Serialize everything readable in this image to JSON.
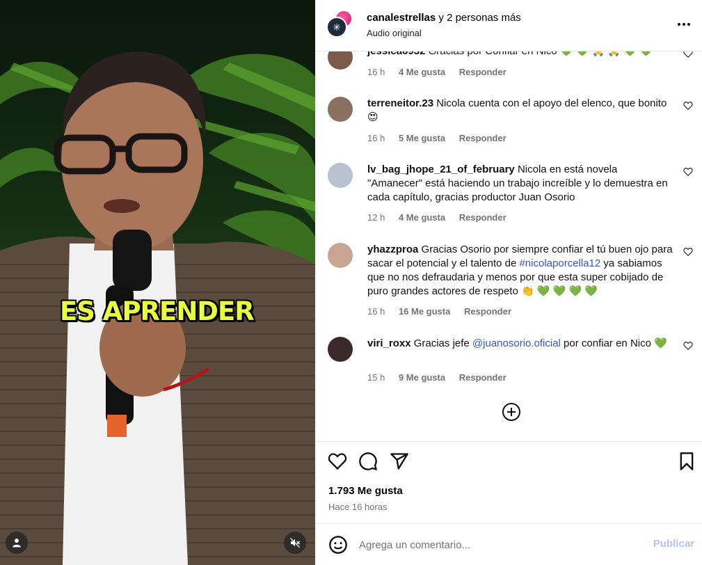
{
  "post": {
    "author": "canalestrellas",
    "coauthors": " y 2 personas más",
    "audio": "Audio original",
    "caption": "ES APRENDER",
    "likes": "1.793 Me gusta",
    "time": "Hace 16 horas"
  },
  "comments": [
    {
      "user": "jessica6932",
      "text": "Gracias por Confiar en Nico",
      "emoji": "💚 💚 🙏 🙏 💚 💚",
      "time": "16 h",
      "likes": "4 Me gusta",
      "reply": "Responder",
      "avatar_color": "#7a5a4a"
    },
    {
      "user": "terreneitor.23",
      "text": "Nicola cuenta con el apoyo del elenco, que bonito",
      "emoji": "😍",
      "time": "16 h",
      "likes": "5 Me gusta",
      "reply": "Responder",
      "avatar_color": "#8a7060"
    },
    {
      "user": "lv_bag_jhope_21_of_february",
      "text": "Nicola en está novela \"Amanecer\" está haciendo un trabajo increíble y lo demuestra en cada capítulo, gracias productor Juan Osorio",
      "time": "12 h",
      "likes": "4 Me gusta",
      "reply": "Responder",
      "avatar_color": "#b9c2cf"
    },
    {
      "user": "yhazzproa",
      "text_before": "Gracias Osorio por siempre confiar el tú buen ojo para sacar el potencial y el talento de ",
      "link": "#nicolaporcella12",
      "text_after": " ya sabiamos que no nos defraudaria y menos por que esta super cobijado de puro grandes actores de respeto",
      "emoji": "👏 💚 💚 💚 💚",
      "time": "16 h",
      "likes": "16 Me gusta",
      "reply": "Responder",
      "avatar_color": "#c9a493"
    },
    {
      "user": "viri_roxx",
      "text_before": "Gracias jefe ",
      "link": "@juanosorio.oficial",
      "text_after": " por confiar en Nico",
      "emoji": "💚",
      "time": "15 h",
      "likes": "9 Me gusta",
      "reply": "Responder",
      "avatar_color": "#3a2a2a"
    }
  ],
  "composer": {
    "placeholder": "Agrega un comentario...",
    "post_label": "Publicar"
  },
  "icons": {
    "more": "more-options-icon",
    "like": "heart-icon",
    "comment": "comment-icon",
    "share": "share-icon",
    "save": "bookmark-icon",
    "add": "add-circle-icon",
    "emoji": "emoji-icon",
    "mute": "muted-speaker-icon",
    "user": "user-tag-icon"
  },
  "colors": {
    "caption": "#e7ff3e",
    "link": "#3358c4",
    "publish_disabled": "#b3c5f4",
    "muted_text": "#737373"
  }
}
